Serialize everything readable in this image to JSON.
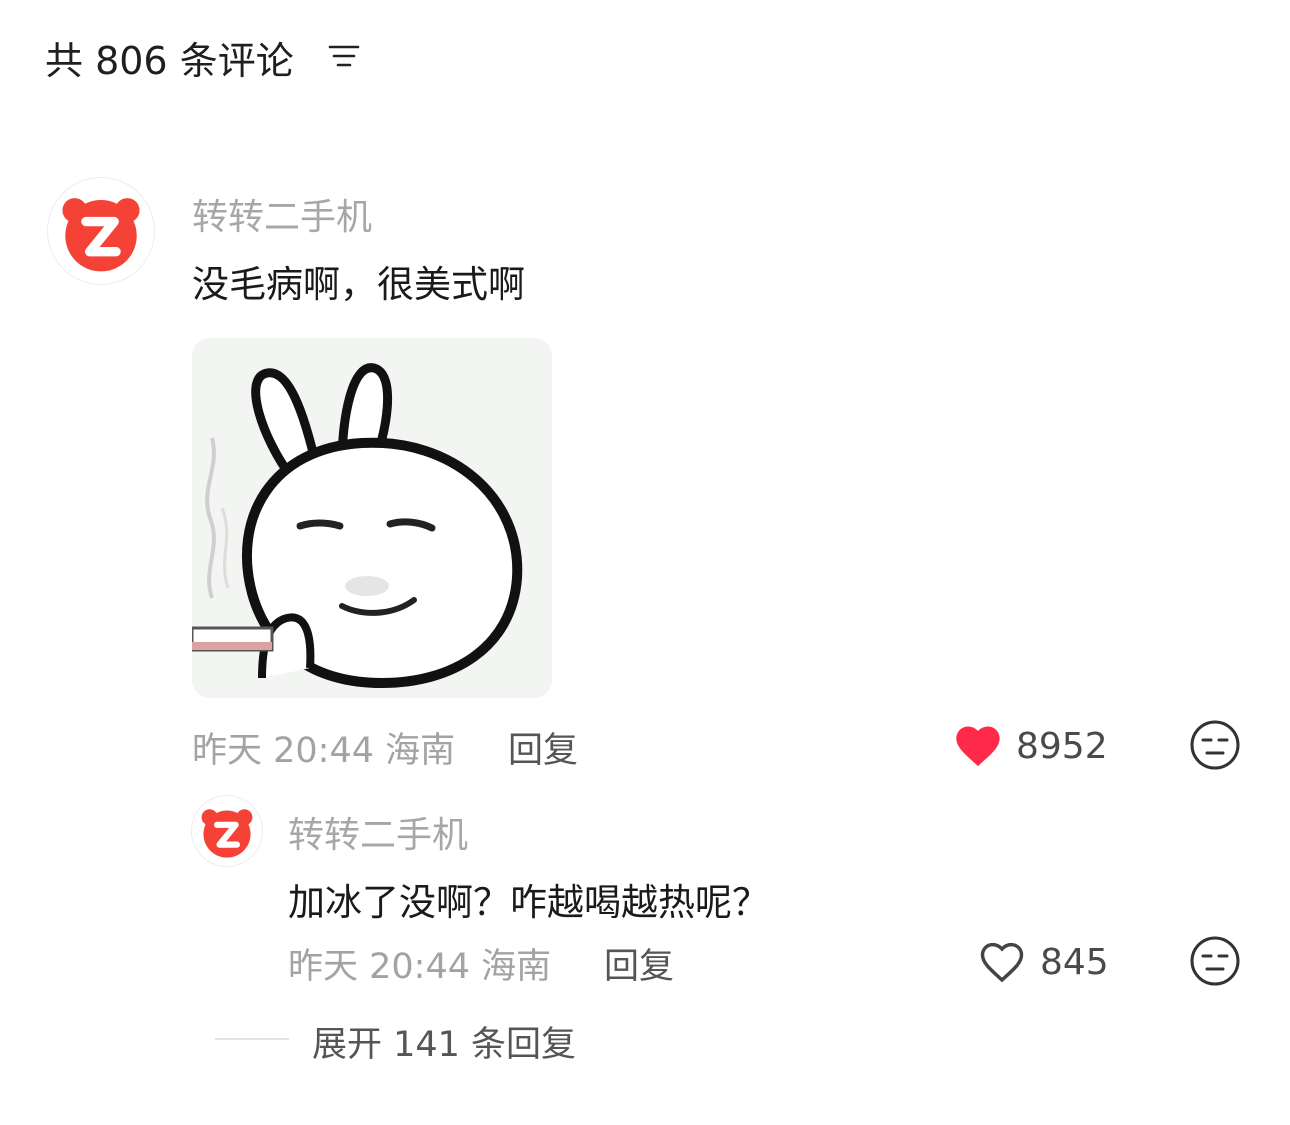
{
  "header": {
    "title": "共 806 条评论"
  },
  "icons": {
    "filter": "filter-lines-icon",
    "avatar": "zhuanzhuan-logo-icon",
    "like": "heart-icon",
    "dislike": "unamused-face-icon",
    "sticker": "smoking-rabbit-sticker"
  },
  "colors": {
    "brand_red": "#f44336",
    "like_red": "#ff2a4a"
  },
  "comment": {
    "username": "转转二手机",
    "text": "没毛病啊，很美式啊",
    "meta": "昨天 20:44 海南",
    "reply_label": "回复",
    "like_count": "8952",
    "liked": true
  },
  "reply": {
    "username": "转转二手机",
    "text": "加冰了没啊？咋越喝越热呢？",
    "meta": "昨天 20:44 海南",
    "reply_label": "回复",
    "like_count": "845",
    "liked": false
  },
  "expand": {
    "label": "展开 141 条回复"
  }
}
